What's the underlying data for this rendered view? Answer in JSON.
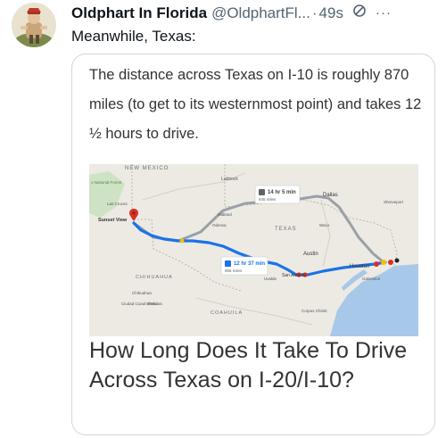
{
  "author": {
    "display_name": "Oldphart In Florida",
    "handle": "@OldphartFl...",
    "separator": "·",
    "timestamp": "49s",
    "icon": "no-entry-icon",
    "more_icon": "more-icon",
    "more_text": "···"
  },
  "tweet": {
    "text": "Meanwhile, Texas:"
  },
  "card": {
    "excerpt": "The distance across Texas on I-10 is roughly 870 miles (to get to its westernmost point) and takes 12 ½ hours to drive.",
    "title": "How Long Does It Take To Drive Across Texas on I-20/I-10?",
    "map": {
      "labels": {
        "new_mexico": "NEW MEXICO",
        "lubbock": "Lubbock",
        "dallas": "Dallas",
        "shreveport": "Shreveport",
        "midland": "Midland",
        "odessa": "Odessa",
        "texas": "TEXAS",
        "waco": "Waco",
        "austin": "Austin",
        "houston": "Houston",
        "san_antonio": "San Antonio",
        "galveston": "Galveston",
        "corpus_christi": "Corpus Christi",
        "sunset_view": "Sunset View",
        "las_cruces": "Las Cruces",
        "national_forest": "o National\nForest",
        "chihuahua_state": "CHIHUAHUA",
        "chihuahua_city": "Chihuahua",
        "delicias": "Delicias",
        "ciudad_cuauhtemoc": "Ciudad\nCuauhtémoc",
        "coahuila": "COAHUILA",
        "uvalde": "Uvalde"
      },
      "route_primary": {
        "duration": "12 hr 37 min",
        "distance": "856 miles"
      },
      "route_alt": {
        "duration": "14 hr 5 min",
        "distance": "945 miles"
      },
      "colors": {
        "primary_route": "#1a73e8",
        "alt_route": "#9aa0a6",
        "water": "#a8c8ea",
        "land": "#eceae3",
        "green": "#cde3c4"
      }
    }
  }
}
